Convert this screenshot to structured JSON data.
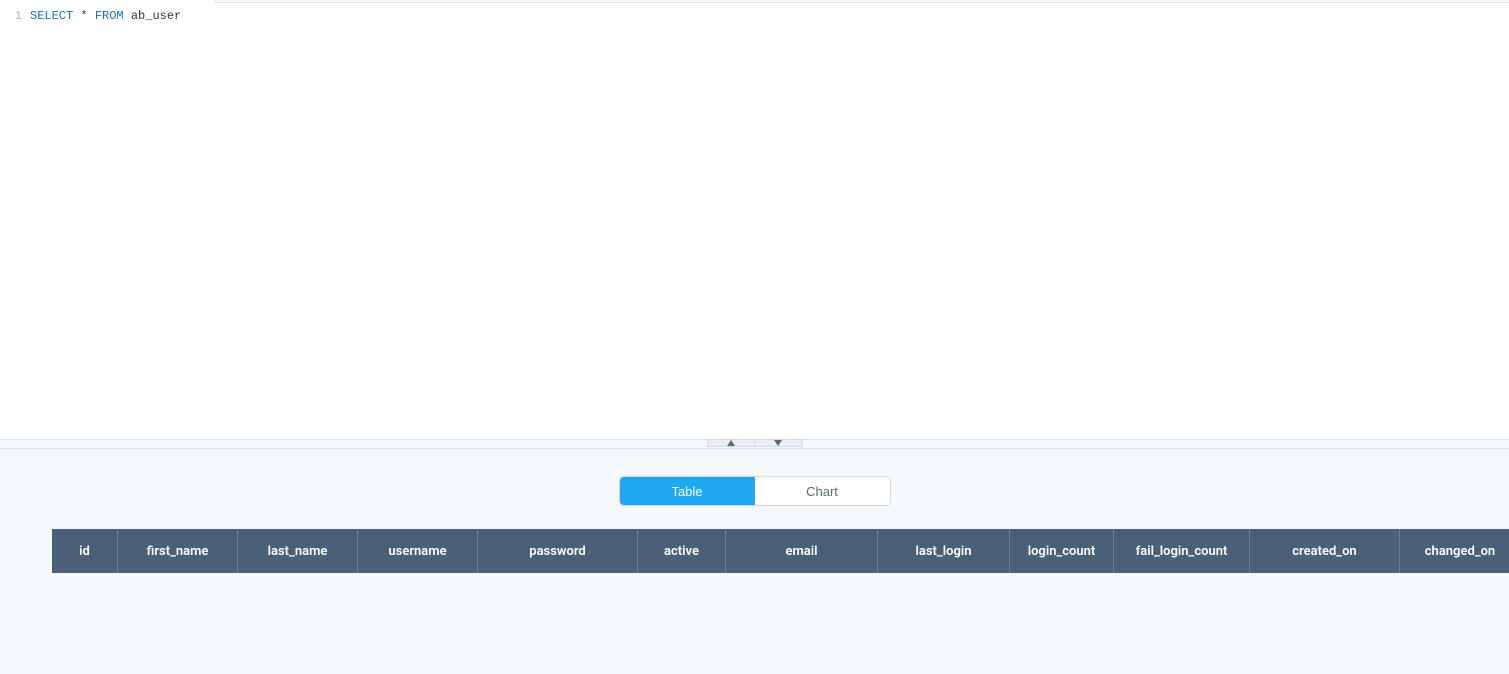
{
  "editor": {
    "line_number": "1",
    "tokens": {
      "select": "SELECT",
      "star": "*",
      "from": "FROM",
      "table": "ab_user"
    }
  },
  "view_toggle": {
    "table": "Table",
    "chart": "Chart"
  },
  "table": {
    "columns": [
      "id",
      "first_name",
      "last_name",
      "username",
      "password",
      "active",
      "email",
      "last_login",
      "login_count",
      "fail_login_count",
      "created_on",
      "changed_on"
    ]
  }
}
